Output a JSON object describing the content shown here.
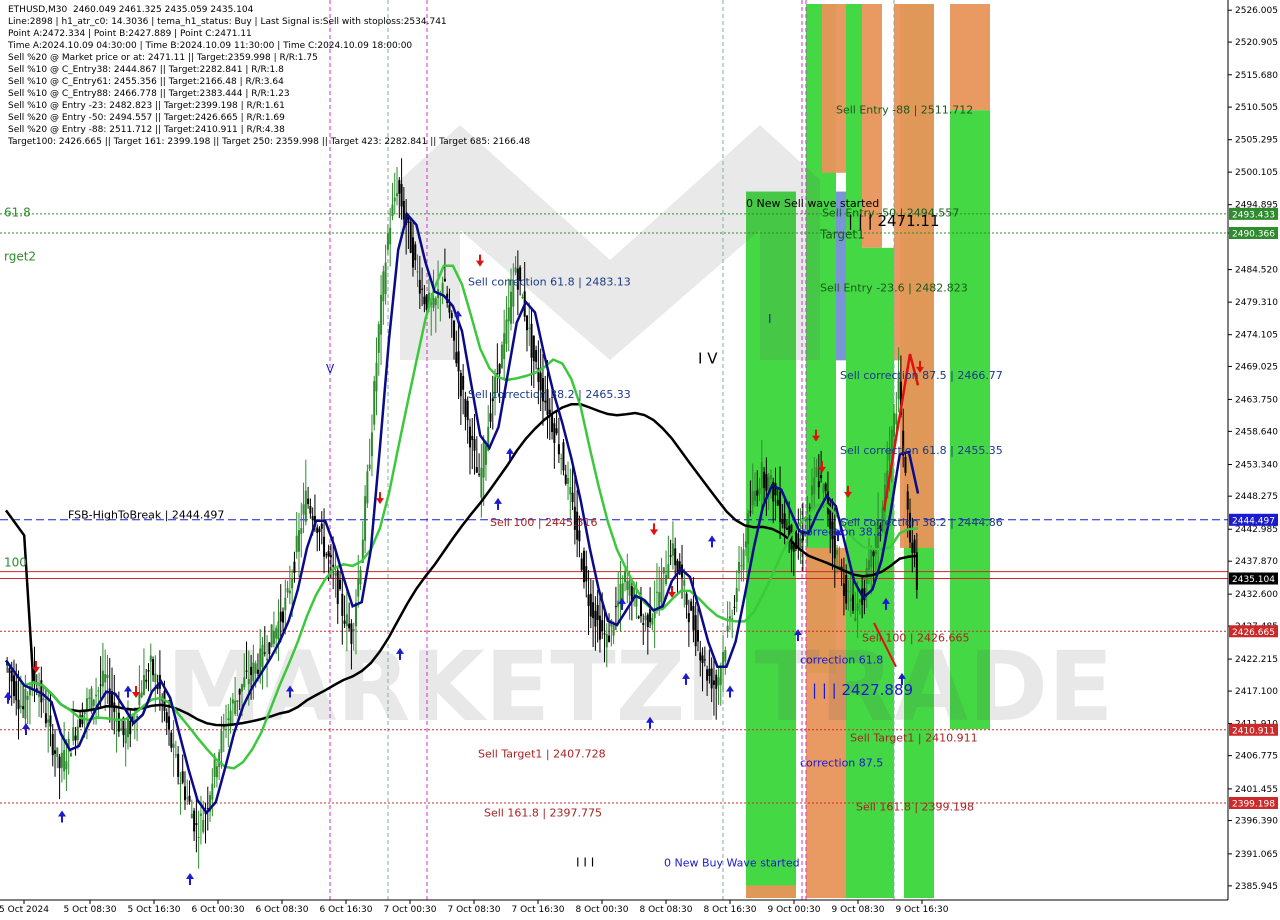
{
  "chart_data": {
    "type": "candlestick",
    "symbol": "ETHUSD,M30",
    "ohlc_header": "2460.049 2461.325 2435.059 2435.104",
    "ylim": [
      2384.0,
      2527.0
    ],
    "y_ticks": [
      2526.005,
      2520.905,
      2515.68,
      2510.505,
      2505.295,
      2500.105,
      2494.895,
      2490.366,
      2484.52,
      2479.31,
      2474.105,
      2469.025,
      2463.75,
      2458.64,
      2453.34,
      2448.275,
      2442.985,
      2437.87,
      2432.6,
      2427.485,
      2422.215,
      2417.1,
      2411.91,
      2406.775,
      2401.455,
      2396.39,
      2391.065,
      2385.945
    ],
    "x_ticks": [
      "5 Oct 2024",
      "5 Oct 08:30",
      "5 Oct 16:30",
      "6 Oct 00:30",
      "6 Oct 08:30",
      "6 Oct 16:30",
      "7 Oct 00:30",
      "7 Oct 08:30",
      "7 Oct 16:30",
      "8 Oct 00:30",
      "8 Oct 08:30",
      "8 Oct 16:30",
      "9 Oct 00:30",
      "9 Oct 08:30",
      "9 Oct 16:30"
    ],
    "close_series": [
      2422,
      2418,
      2414,
      2420,
      2416,
      2410,
      2405,
      2408,
      2412,
      2415,
      2417,
      2419,
      2414,
      2410,
      2412,
      2418,
      2421,
      2417,
      2410,
      2404,
      2400,
      2395,
      2398,
      2405,
      2411,
      2415,
      2418,
      2420,
      2422,
      2425,
      2428,
      2432,
      2440,
      2448,
      2445,
      2440,
      2436,
      2430,
      2426,
      2438,
      2455,
      2475,
      2490,
      2498,
      2492,
      2485,
      2480,
      2478,
      2483,
      2475,
      2466,
      2458,
      2450,
      2460,
      2468,
      2475,
      2485,
      2478,
      2470,
      2465,
      2460,
      2455,
      2448,
      2440,
      2432,
      2428,
      2425,
      2430,
      2435,
      2432,
      2428,
      2430,
      2434,
      2440,
      2436,
      2430,
      2425,
      2420,
      2418,
      2425,
      2432,
      2440,
      2448,
      2452,
      2450,
      2446,
      2442,
      2440,
      2445,
      2452,
      2448,
      2440,
      2434,
      2430,
      2432,
      2438,
      2444,
      2455,
      2466,
      2445,
      2435.104
    ],
    "price_labels": [
      {
        "value": 2493.433,
        "text": "2493.433",
        "bg": "#2e8b2e"
      },
      {
        "value": 2490.366,
        "text": "2490.366",
        "bg": "#2e8b2e"
      },
      {
        "value": 2444.497,
        "text": "2444.497",
        "bg": "#1a1ad0"
      },
      {
        "value": 2435.104,
        "text": "2435.104",
        "bg": "#000000"
      },
      {
        "value": 2426.665,
        "text": "2426.665",
        "bg": "#cc2a2a"
      },
      {
        "value": 2410.911,
        "text": "2410.911",
        "bg": "#cc2a2a"
      },
      {
        "value": 2399.198,
        "text": "2399.198",
        "bg": "#cc2a2a"
      }
    ],
    "annotations": [
      {
        "text": "Sell Entry -88 | 2511.712",
        "color": "#1a5a1a"
      },
      {
        "text": "Sell Entry -50 | 2494.557",
        "color": "#1a5a1a"
      },
      {
        "text": "| | | 2471.11",
        "color": "#000000"
      },
      {
        "text": "Target1",
        "color": "#1a5a1a"
      },
      {
        "text": "Sell Entry -23.6 | 2482.823",
        "color": "#1a5a1a"
      },
      {
        "text": "Sell correction 87.5 | 2466.77",
        "color": "#1a3a8a"
      },
      {
        "text": "Sell correction 61.8 | 2455.35",
        "color": "#1a3a8a"
      },
      {
        "text": "Sell correction 38.2 | 2444.86",
        "color": "#1a3a8a"
      },
      {
        "text": "Sell 100 | 2426.665",
        "color": "#aa2222"
      },
      {
        "text": "Sell Target1 | 2410.911",
        "color": "#aa2222"
      },
      {
        "text": "Sell 161.8 | 2399.198",
        "color": "#aa2222"
      },
      {
        "text": "Sell correction 61.8 | 2483.13",
        "color": "#1a3a8a"
      },
      {
        "text": "Sell correction 38.2 | 2465.33",
        "color": "#1a3a8a"
      },
      {
        "text": "Sell 100 | 2445.316",
        "color": "#aa2222"
      },
      {
        "text": "Sell Target1 | 2407.728",
        "color": "#aa2222"
      },
      {
        "text": "Sell 161.8 | 2397.775",
        "color": "#aa2222"
      },
      {
        "text": "0 New Sell wave started",
        "color": "#000000"
      },
      {
        "text": "0 New Buy Wave started",
        "color": "#1a1ad0"
      },
      {
        "text": "correction 38.2",
        "color": "#1a1ad0"
      },
      {
        "text": "correction 61.8",
        "color": "#1a1ad0"
      },
      {
        "text": "correction 87.5",
        "color": "#1a1ad0"
      },
      {
        "text": "| | | 2427.889",
        "color": "#1a1ad0"
      },
      {
        "text": "FSB-HighToBreak | 2444.497",
        "color": "#000000"
      },
      {
        "text": "I V",
        "color": "#000000"
      },
      {
        "text": "I",
        "color": "#1a1ad0"
      },
      {
        "text": "V",
        "color": "#1a1ad0"
      },
      {
        "text": "I I I",
        "color": "#000000"
      },
      {
        "text": "61.8",
        "color": "#2e8b2e"
      },
      {
        "text": "rget2",
        "color": "#2e8b2e"
      },
      {
        "text": "100",
        "color": "#2e8b2e"
      }
    ]
  },
  "info_lines": [
    "ETHUSD,M30  2460.049 2461.325 2435.059 2435.104",
    "Line:2898 | h1_atr_c0: 14.3036 | tema_h1_status: Buy | Last Signal is:Sell with stoploss:2534.741",
    "Point A:2472.334 | Point B:2427.889 | Point C:2471.11",
    "Time A:2024.10.09 04:30:00 | Time B:2024.10.09 11:30:00 | Time C:2024.10.09 18:00:00",
    "Sell %20 @ Market price or at: 2471.11 || Target:2359.998 | R/R:1.75",
    "Sell %10 @ C_Entry38: 2444.867 || Target:2282.841 | R/R:1.8",
    "Sell %10 @ C_Entry61: 2455.356 || Target:2166.48 | R/R:3.64",
    "Sell %10 @ C_Entry88: 2466.778 || Target:2383.444 | R/R:1.23",
    "Sell %10 @ Entry -23: 2482.823 || Target:2399.198 | R/R:1.61",
    "Sell %20 @ Entry -50: 2494.557 || Target:2426.665 | R/R:1.69",
    "Sell %20 @ Entry -88: 2511.712 || Target:2410.911 | R/R:4.38",
    "Target100: 2426.665 || Target 161: 2399.198 || Target 250: 2359.998 || Target 423: 2282.841 || Target 685: 2166.48"
  ],
  "watermark": "MARKETZI TRADE",
  "colors": {
    "bull": "#2e8b2e",
    "bear": "#000000",
    "green_zone": "#3ad63a",
    "orange_zone": "#e8955a",
    "blue_ma": "#0a0a8a",
    "green_ma": "#3cc83c",
    "black_ma": "#000000"
  }
}
